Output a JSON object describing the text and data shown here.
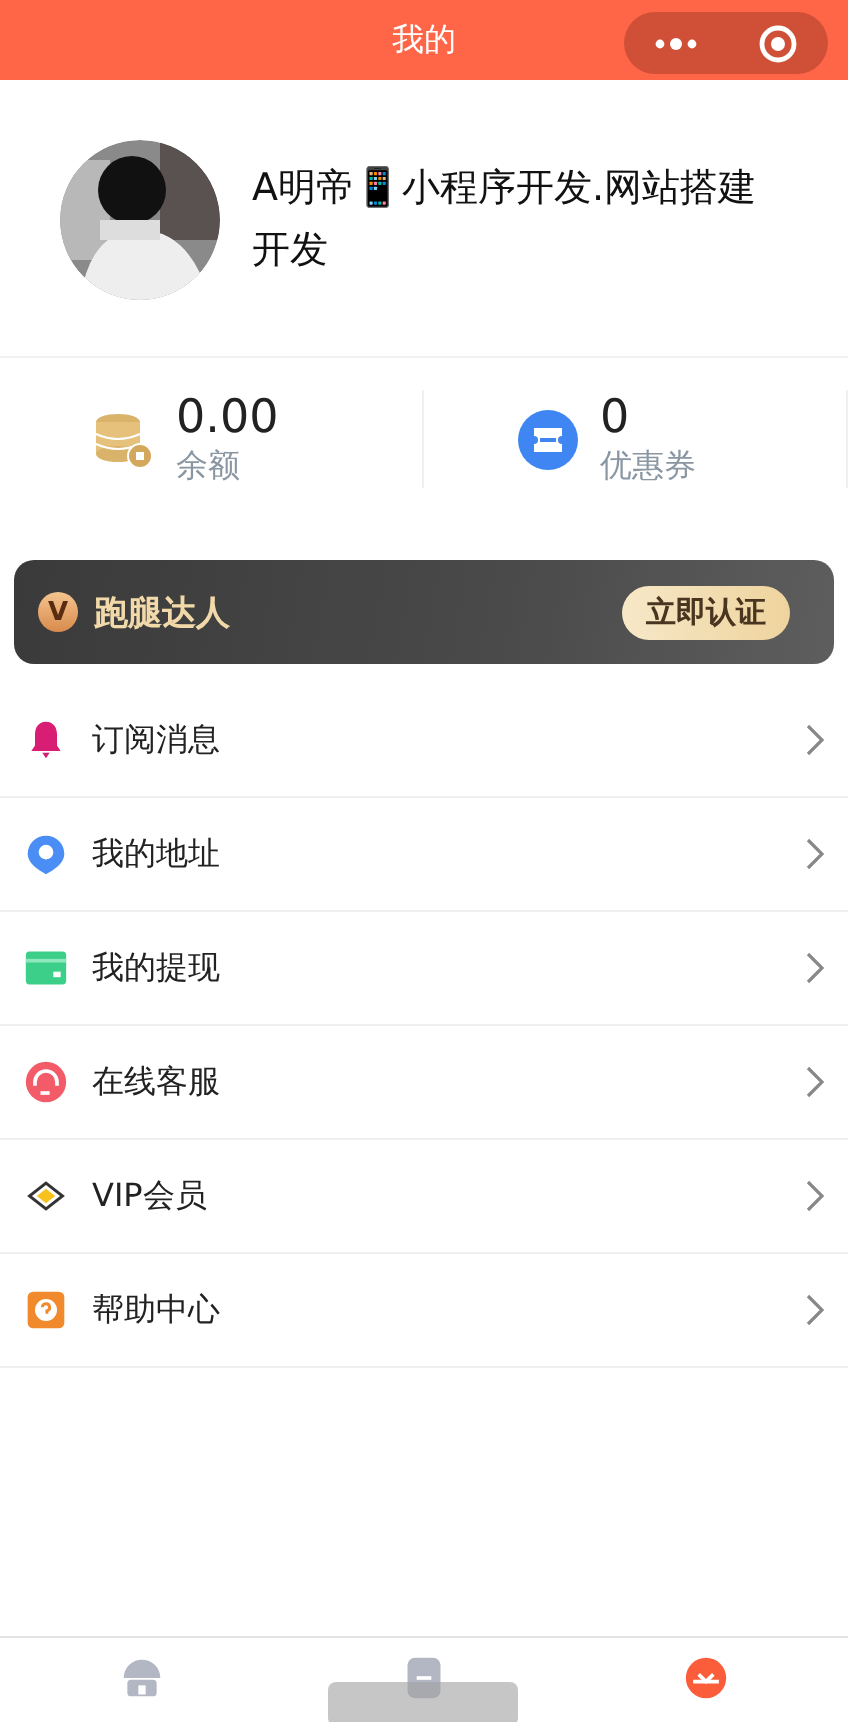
{
  "nav_bar": {
    "title": "我的"
  },
  "profile": {
    "name": "A明帝📱小程序开发.网站搭建开发"
  },
  "stats": [
    {
      "kind": "balance",
      "value": "0.00",
      "label": "余额"
    },
    {
      "kind": "coupon",
      "value": "0",
      "label": "优惠券"
    }
  ],
  "banner": {
    "title": "跑腿达人",
    "badge": "V",
    "button": "立即认证"
  },
  "menu": [
    {
      "kind": "bell",
      "label": "订阅消息"
    },
    {
      "kind": "pin",
      "label": "我的地址"
    },
    {
      "kind": "card",
      "label": "我的提现"
    },
    {
      "kind": "service",
      "label": "在线客服"
    },
    {
      "kind": "diamond",
      "label": "VIP会员"
    },
    {
      "kind": "help",
      "label": "帮助中心"
    }
  ],
  "tab_bar": [
    {
      "kind": "home",
      "selected": false
    },
    {
      "kind": "download",
      "selected": false
    },
    {
      "kind": "mine",
      "selected": true
    }
  ]
}
